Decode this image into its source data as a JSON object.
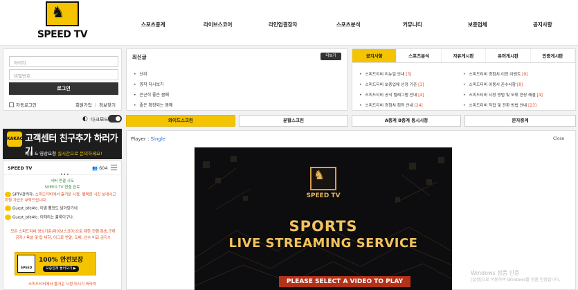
{
  "logo": {
    "text": "SPEED TV"
  },
  "nav": [
    "스포츠중계",
    "라이브스코어",
    "라인업결장자",
    "스포츠분석",
    "커뮤니티",
    "보증업체",
    "공지사항"
  ],
  "login": {
    "id_placeholder": "아이디",
    "pw_placeholder": "비밀번호",
    "login_label": "로그인",
    "auto_login": "자동로그인",
    "join": "회원가입",
    "find": "정보찾기"
  },
  "darkmode": {
    "label": "다크모드"
  },
  "kakao_banner": {
    "badge": "KAKAO",
    "title": "고객센터 친구추가 하러가기",
    "sub_prefix": "제휴 & 영상요청 ",
    "sub_highlight": "실시간으로 문의하세요!"
  },
  "chat": {
    "title": "SPEED TV",
    "users": "604",
    "system_1": "서버 연결 시도",
    "system_2": "SPEED TV 연결 완료",
    "msg1_who": "SPTV관리자:",
    "msg1_text": "스피드티비에서 즐거운 시청, 행복한 시간 보내시고 회원 가입도 부탁드립니다.",
    "msg2_who": "Guest_bfe4fc",
    "msg2_text": "이열 뿅한도 날아망기네",
    "msg3_who": "Guest_bfe4fc",
    "msg3_text": "이때리는 훌룩이구나.",
    "notice": "모든 스피드티비 영상기준(라이브스코어)으로 제한 진행 특송,구류 공지 / 욕설 및 탑 비하, 어그로 반말, 도배, 선수 비교 금지!!",
    "banner_text": "100% 안전보장",
    "banner_sub": "보증업체 둘러보기 ▶",
    "banner_logo": "SPEED TV",
    "footer": "스피드티비에서 즐거운 시청 되시기 바라며"
  },
  "latest": {
    "title": "최신글",
    "more": "더보기",
    "items": [
      "난리",
      "영작 다시보기",
      "은근히 좋은 몸매",
      "좋은 확장되는 몸매"
    ]
  },
  "board": {
    "tabs": [
      "공지사항",
      "스포츠분석",
      "자유게시판",
      "유머게시판",
      "인증게시판"
    ],
    "left": [
      {
        "text": "스피드티비 리뉴얼 안내 ",
        "count": "[3]"
      },
      {
        "text": "스피드티비 보증업체 선정 기준 ",
        "count": "[3]"
      },
      {
        "text": "스피드티비 공식 텔레그램 안내 ",
        "count": "[4]"
      },
      {
        "text": "스피드티비 경험치 획득 안내 ",
        "count": "[24]"
      }
    ],
    "right": [
      {
        "text": "스피드티비 경험치 이전 이벤트 ",
        "count": "[9]"
      },
      {
        "text": "스피드티비 이용시 준수사항 ",
        "count": "[8]"
      },
      {
        "text": "스피드티비 시청 방법 및 모류 현상 해결 ",
        "count": "[4]"
      },
      {
        "text": "스피드티비 직접 및 전환 방법 안내 ",
        "count": "[23]"
      }
    ]
  },
  "modes": [
    "와이드스크린",
    "분할스크린",
    "A중계 B중계 동시시청",
    "문자중계"
  ],
  "player": {
    "label_prefix": "Player : ",
    "label_mode": "Single",
    "close": "Close",
    "video_logo": "SPEED TV",
    "line1": "SPORTS",
    "line2": "LIVE STREAMING SERVICE",
    "cta": "PLEASE SELECT A VIDEO TO PLAY"
  },
  "watermark": {
    "line1": "Windows 정품 인증",
    "line2": "[설정]으로 이동하여 Windows를 정품 인증합니다."
  },
  "colors": {
    "accent": "#f5c400",
    "link": "#2c6fd6",
    "count": "#e0461b"
  }
}
